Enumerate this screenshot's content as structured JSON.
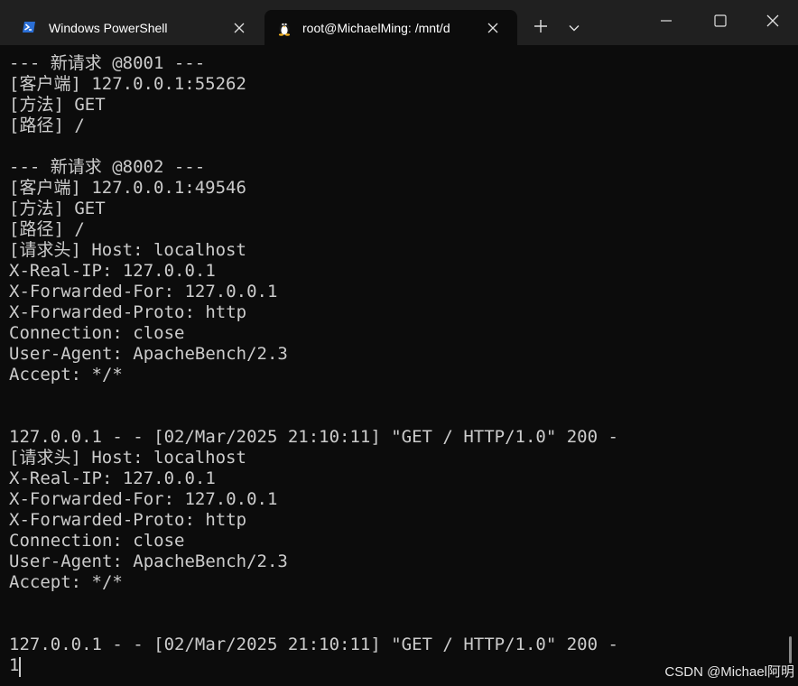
{
  "tabs": [
    {
      "title": "Windows PowerShell",
      "icon": "powershell-icon",
      "active": false
    },
    {
      "title": "root@MichaelMing: /mnt/d",
      "icon": "linux-tux-icon",
      "active": true
    }
  ],
  "titlebar": {
    "new_tab_icon": "plus-icon",
    "dropdown_icon": "chevron-down-icon",
    "minimize_icon": "minimize-icon",
    "maximize_icon": "maximize-icon",
    "close_icon": "close-icon"
  },
  "terminal": {
    "lines": [
      "--- 新请求 @8001 ---",
      "[客户端] 127.0.0.1:55262",
      "[方法] GET",
      "[路径] /",
      "",
      "--- 新请求 @8002 ---",
      "[客户端] 127.0.0.1:49546",
      "[方法] GET",
      "[路径] /",
      "[请求头] Host: localhost",
      "X-Real-IP: 127.0.0.1",
      "X-Forwarded-For: 127.0.0.1",
      "X-Forwarded-Proto: http",
      "Connection: close",
      "User-Agent: ApacheBench/2.3",
      "Accept: */*",
      "",
      "",
      "127.0.0.1 - - [02/Mar/2025 21:10:11] \"GET / HTTP/1.0\" 200 -",
      "[请求头] Host: localhost",
      "X-Real-IP: 127.0.0.1",
      "X-Forwarded-For: 127.0.0.1",
      "X-Forwarded-Proto: http",
      "Connection: close",
      "User-Agent: ApacheBench/2.3",
      "Accept: */*",
      "",
      "",
      "127.0.0.1 - - [02/Mar/2025 21:10:11] \"GET / HTTP/1.0\" 200 -",
      "1"
    ]
  },
  "watermark": "CSDN @Michael阿明",
  "colors": {
    "titlebar_bg": "#202020",
    "terminal_bg": "#0c0c0c",
    "terminal_fg": "#cccccc",
    "powershell_blue": "#2b6fd6"
  }
}
